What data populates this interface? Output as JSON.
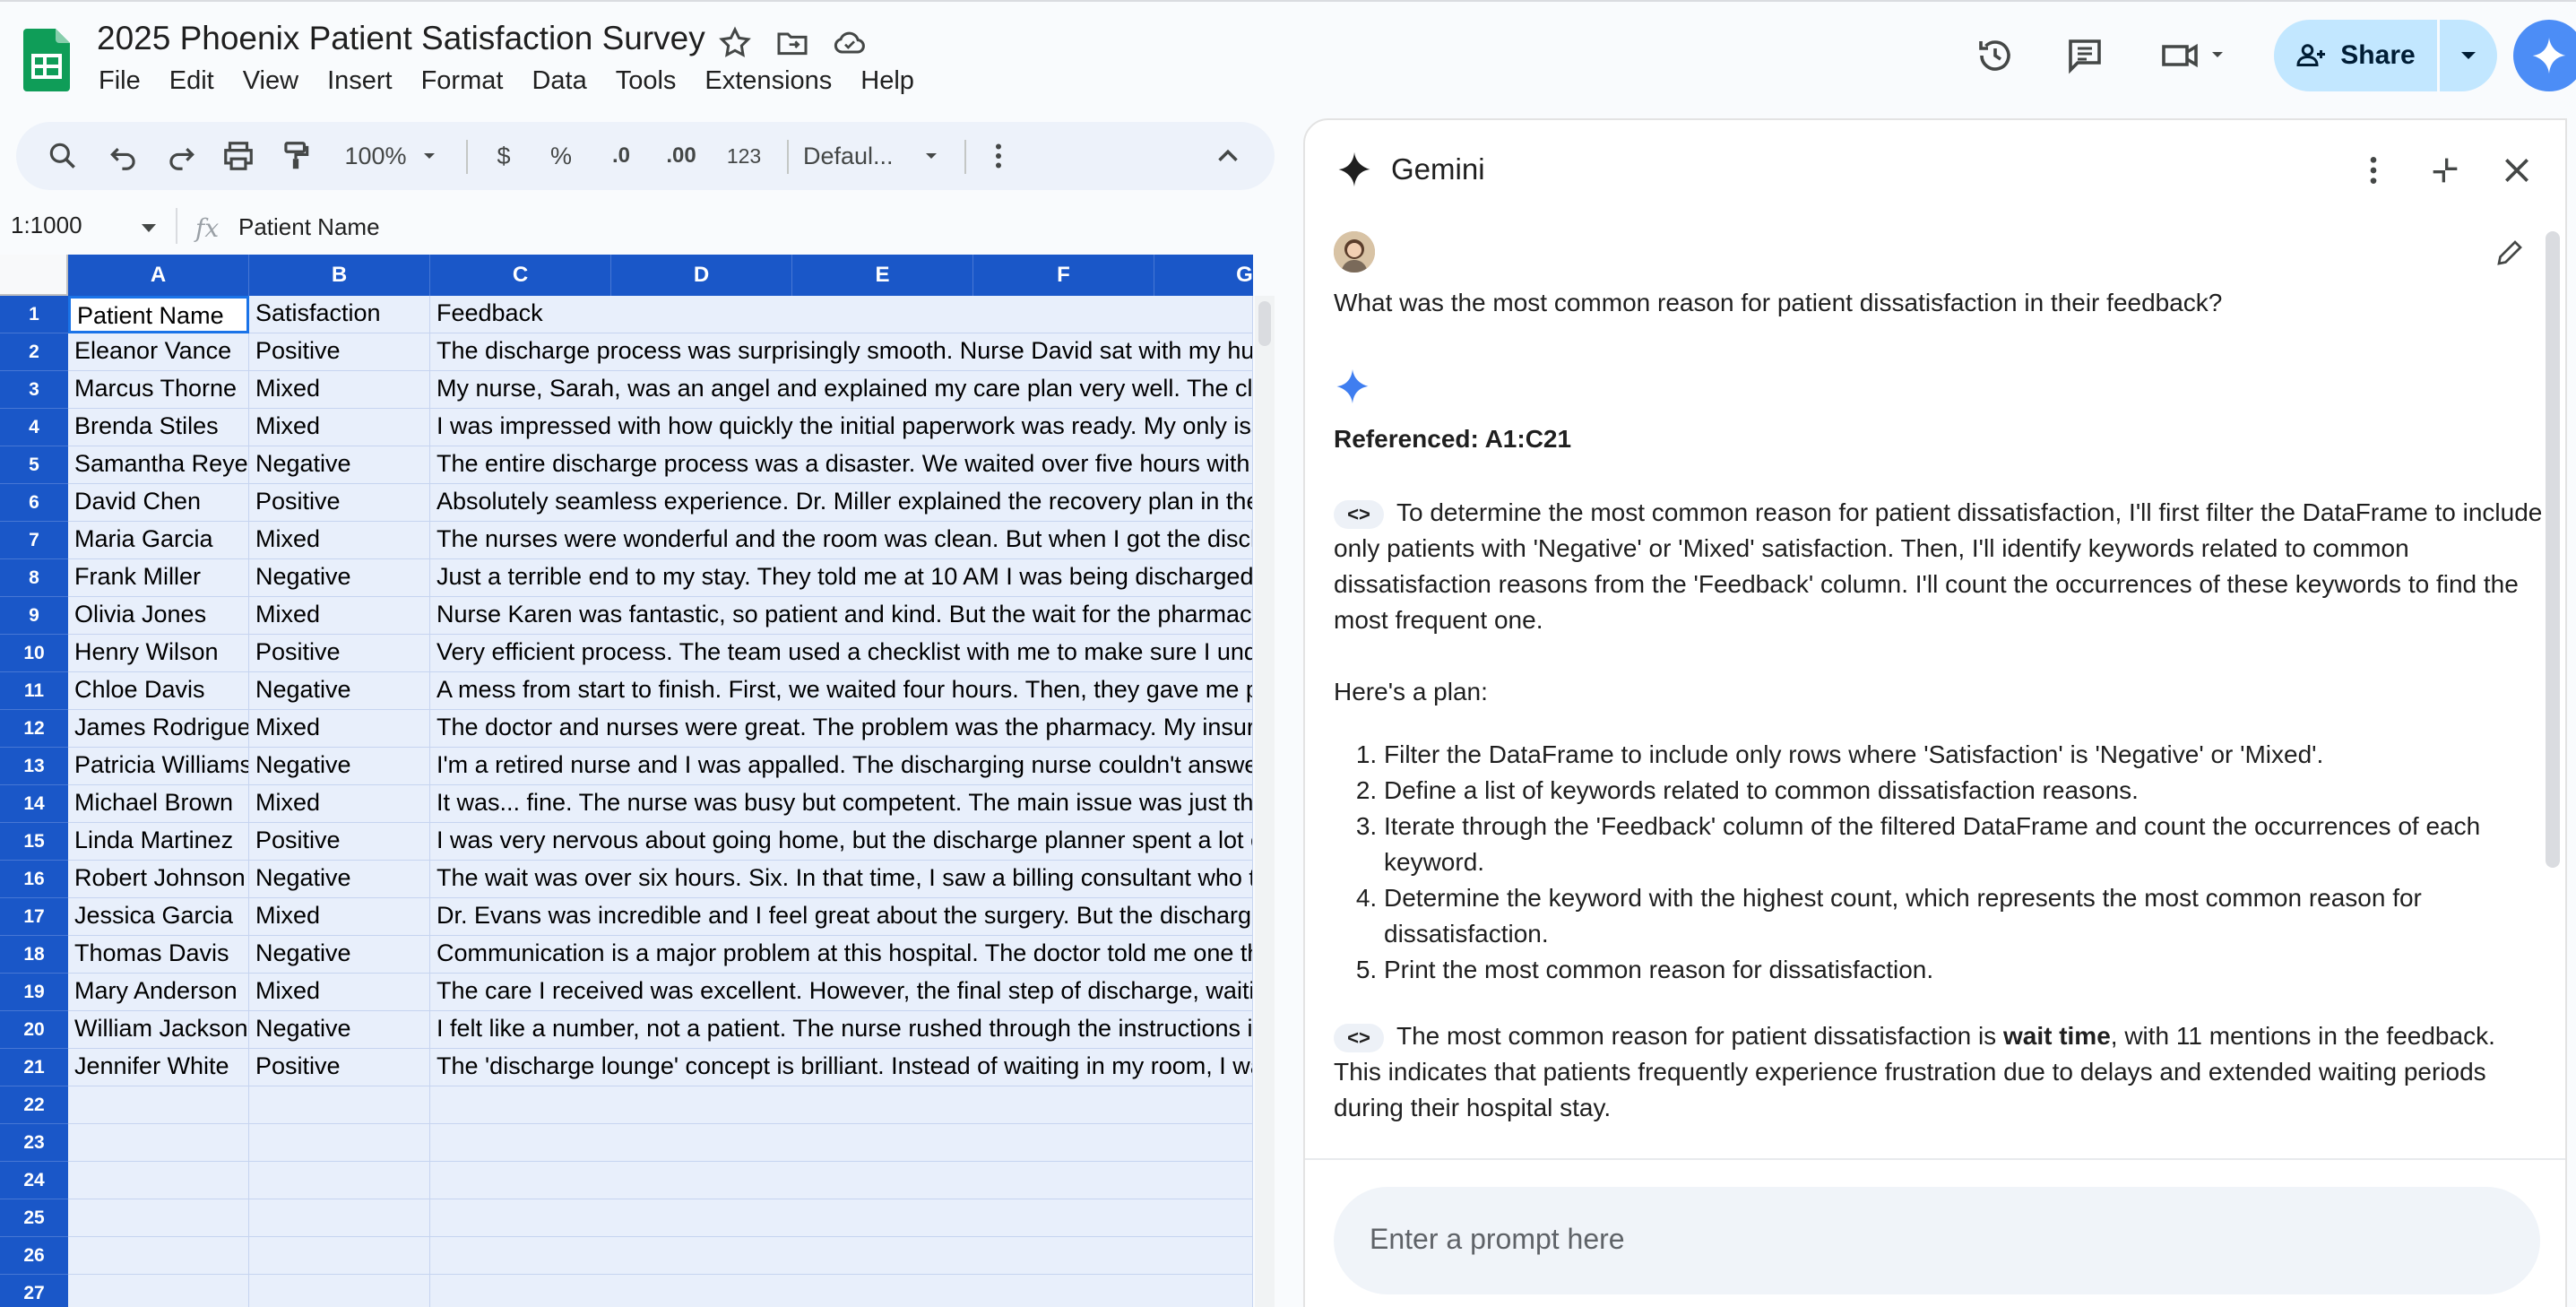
{
  "app": {
    "doc_title": "2025 Phoenix Patient Satisfaction Survey",
    "menus": [
      "File",
      "Edit",
      "View",
      "Insert",
      "Format",
      "Data",
      "Tools",
      "Extensions",
      "Help"
    ],
    "share_label": "Share"
  },
  "toolbar": {
    "zoom": "100%",
    "currency": "$",
    "percent": "%",
    "dec_decrease": ".0",
    "dec_increase": ".00",
    "number_format": "123",
    "font": "Defaul..."
  },
  "formula_bar": {
    "name_box": "1:1000",
    "fx": "fx",
    "formula": "Patient Name"
  },
  "sheet": {
    "columns": [
      "A",
      "B",
      "C",
      "D",
      "E",
      "F",
      "G"
    ],
    "rows": [
      {
        "n": "1",
        "a": "Patient Name",
        "b": "Satisfaction",
        "c": "Feedback"
      },
      {
        "n": "2",
        "a": "Eleanor Vance",
        "b": "Positive",
        "c": "The discharge process was surprisingly smooth. Nurse David sat with my hus"
      },
      {
        "n": "3",
        "a": "Marcus Thorne",
        "b": "Mixed",
        "c": "My nurse, Sarah, was an angel and explained my care plan very well. The clir"
      },
      {
        "n": "4",
        "a": "Brenda Stiles",
        "b": "Mixed",
        "c": "I was impressed with how quickly the initial paperwork was ready. My only iss"
      },
      {
        "n": "5",
        "a": "Samantha Reyes",
        "b": "Negative",
        "c": "The entire discharge process was a disaster. We waited over five hours with n"
      },
      {
        "n": "6",
        "a": "David Chen",
        "b": "Positive",
        "c": "Absolutely seamless experience. Dr. Miller explained the recovery plan in the"
      },
      {
        "n": "7",
        "a": "Maria Garcia",
        "b": "Mixed",
        "c": "The nurses were wonderful and the room was clean. But when I got the disch"
      },
      {
        "n": "8",
        "a": "Frank Miller",
        "b": "Negative",
        "c": "Just a terrible end to my stay. They told me at 10 AM I was being discharged."
      },
      {
        "n": "9",
        "a": "Olivia Jones",
        "b": "Mixed",
        "c": "Nurse Karen was fantastic, so patient and kind. But the wait for the pharmacy"
      },
      {
        "n": "10",
        "a": "Henry Wilson",
        "b": "Positive",
        "c": "Very efficient process. The team used a checklist with me to make sure I unde"
      },
      {
        "n": "11",
        "a": "Chloe Davis",
        "b": "Negative",
        "c": "A mess from start to finish. First, we waited four hours. Then, they gave me pa"
      },
      {
        "n": "12",
        "a": "James Rodriguez",
        "b": "Mixed",
        "c": "The doctor and nurses were great. The problem was the pharmacy. My insura"
      },
      {
        "n": "13",
        "a": "Patricia Williams",
        "b": "Negative",
        "c": "I'm a retired nurse and I was appalled. The discharging nurse couldn't answer"
      },
      {
        "n": "14",
        "a": "Michael Brown",
        "b": "Mixed",
        "c": "It was... fine. The nurse was busy but competent. The main issue was just the"
      },
      {
        "n": "15",
        "a": "Linda Martinez",
        "b": "Positive",
        "c": "I was very nervous about going home, but the discharge planner spent a lot o"
      },
      {
        "n": "16",
        "a": "Robert Johnson",
        "b": "Negative",
        "c": "The wait was over six hours. Six. In that time, I saw a billing consultant who tr"
      },
      {
        "n": "17",
        "a": "Jessica Garcia",
        "b": "Mixed",
        "c": "Dr. Evans was incredible and I feel great about the surgery. But the discharge"
      },
      {
        "n": "18",
        "a": "Thomas Davis",
        "b": "Negative",
        "c": "Communication is a major problem at this hospital. The doctor told me one th"
      },
      {
        "n": "19",
        "a": "Mary Anderson",
        "b": "Mixed",
        "c": "The care I received was excellent. However, the final step of discharge, waitin"
      },
      {
        "n": "20",
        "a": "William Jackson",
        "b": "Negative",
        "c": "I felt like a number, not a patient. The nurse rushed through the instructions ir"
      },
      {
        "n": "21",
        "a": "Jennifer White",
        "b": "Positive",
        "c": "The 'discharge lounge' concept is brilliant. Instead of waiting in my room, I wa"
      },
      {
        "n": "22",
        "a": "",
        "b": "",
        "c": ""
      },
      {
        "n": "23",
        "a": "",
        "b": "",
        "c": ""
      },
      {
        "n": "24",
        "a": "",
        "b": "",
        "c": ""
      },
      {
        "n": "25",
        "a": "",
        "b": "",
        "c": ""
      },
      {
        "n": "26",
        "a": "",
        "b": "",
        "c": ""
      },
      {
        "n": "27",
        "a": "",
        "b": "",
        "c": ""
      }
    ]
  },
  "gemini": {
    "title": "Gemini",
    "question": "What was the most common reason for patient dissatisfaction in their feedback?",
    "referenced": "Referenced: A1:C21",
    "code_chip": "<>",
    "para1": "To determine the most common reason for patient dissatisfaction, I'll first filter the DataFrame to include only patients with 'Negative' or 'Mixed' satisfaction. Then, I'll identify keywords related to common dissatisfaction reasons from the 'Feedback' column. I'll count the occurrences of these keywords to find the most frequent one.",
    "plan_intro": "Here's a plan:",
    "plan": [
      "Filter the DataFrame to include only rows where 'Satisfaction' is 'Negative' or 'Mixed'.",
      "Define a list of keywords related to common dissatisfaction reasons.",
      "Iterate through the 'Feedback' column of the filtered DataFrame and count the occurrences of each keyword.",
      "Determine the keyword with the highest count, which represents the most common reason for dissatisfaction.",
      "Print the most common reason for dissatisfaction."
    ],
    "result_pre": "The most common reason for patient dissatisfaction is ",
    "result_bold": "wait time",
    "result_post": ", with 11 mentions in the feedback. This indicates that patients frequently experience frustration due to delays and extended waiting periods during their hospital stay.",
    "prompt_placeholder": "Enter a prompt here"
  },
  "colors": {
    "header_blue": "#1a57c8",
    "cell_selected": "#e8effb",
    "share_bg": "#c2e7ff",
    "gemini_blue": "#4c8df6"
  }
}
